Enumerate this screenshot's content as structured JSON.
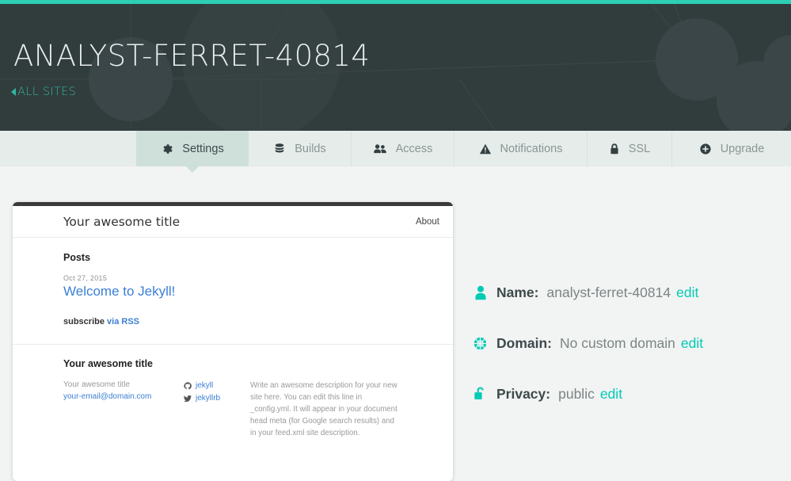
{
  "header": {
    "site_title": "ANALYST-FERRET-40814",
    "back_link": "ALL SITES",
    "accent_color": "#2ccfb5",
    "background_color": "#313c3d"
  },
  "tabs": [
    {
      "label": "Settings",
      "icon": "gear-icon",
      "active": true
    },
    {
      "label": "Builds",
      "icon": "database-icon",
      "active": false
    },
    {
      "label": "Access",
      "icon": "users-icon",
      "active": false
    },
    {
      "label": "Notifications",
      "icon": "warning-triangle-icon",
      "active": false
    },
    {
      "label": "SSL",
      "icon": "lock-icon",
      "active": false
    },
    {
      "label": "Upgrade",
      "icon": "plus-circle-icon",
      "active": false
    }
  ],
  "preview": {
    "site_title": "Your awesome title",
    "nav_link": "About",
    "posts_heading": "Posts",
    "post": {
      "date": "Oct 27, 2015",
      "title": "Welcome to Jekyll!"
    },
    "subscribe_text": "subscribe",
    "subscribe_link": "via RSS",
    "footer": {
      "title": "Your awesome title",
      "name": "Your awesome title",
      "email": "your-email@domain.com",
      "github": "jekyll",
      "twitter": "jekyllrb",
      "description": "Write an awesome description for your new site here. You can edit this line in _config.yml. It will appear in your document head meta (for Google search results) and in your feed.xml site description."
    }
  },
  "settings": {
    "edit_label": "edit",
    "rows": [
      {
        "icon": "person-icon",
        "label": "Name:",
        "value": "analyst-ferret-40814"
      },
      {
        "icon": "globe-icon",
        "label": "Domain:",
        "value": "No custom domain"
      },
      {
        "icon": "unlock-icon",
        "label": "Privacy:",
        "value": "public"
      }
    ]
  }
}
